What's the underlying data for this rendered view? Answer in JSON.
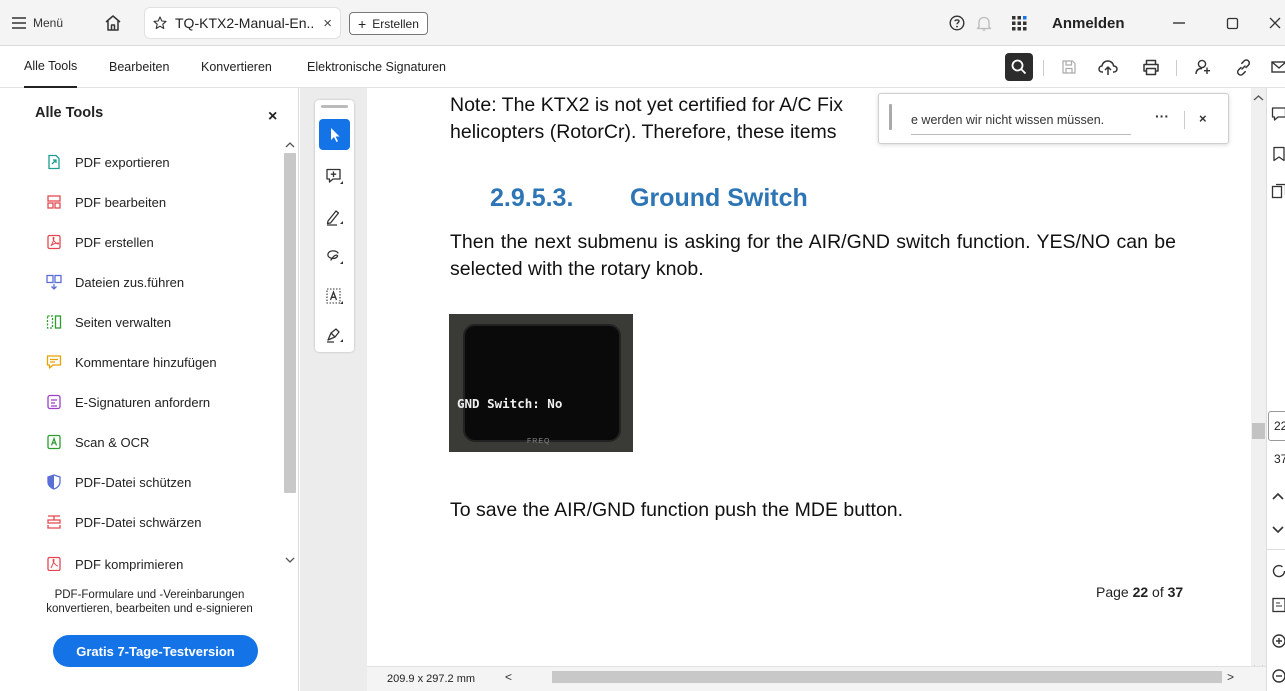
{
  "titlebar": {
    "menu_label": "Menü",
    "tab_title": "TQ-KTX2-Manual-En...",
    "tab_close": "×",
    "create_label": "Erstellen",
    "create_plus": "+",
    "signin_label": "Anmelden"
  },
  "toolsbar": {
    "menus": [
      "Alle Tools",
      "Bearbeiten",
      "Konvertieren",
      "Elektronische Signaturen"
    ]
  },
  "leftpanel": {
    "title": "Alle Tools",
    "close": "×",
    "items": [
      {
        "label": "PDF exportieren",
        "icon": "export-pdf-icon",
        "color": "#1a9e8f"
      },
      {
        "label": "PDF bearbeiten",
        "icon": "edit-pdf-icon",
        "color": "#e34850"
      },
      {
        "label": "PDF erstellen",
        "icon": "create-pdf-icon",
        "color": "#e34850"
      },
      {
        "label": "Dateien zus.führen",
        "icon": "combine-files-icon",
        "color": "#5a6fd6"
      },
      {
        "label": "Seiten verwalten",
        "icon": "organize-pages-icon",
        "color": "#2d9d2d"
      },
      {
        "label": "Kommentare hinzufügen",
        "icon": "comment-icon",
        "color": "#e8a000"
      },
      {
        "label": "E-Signaturen anfordern",
        "icon": "request-signature-icon",
        "color": "#9b3fc9"
      },
      {
        "label": "Scan & OCR",
        "icon": "scan-ocr-icon",
        "color": "#2d9d2d"
      },
      {
        "label": "PDF-Datei schützen",
        "icon": "protect-pdf-icon",
        "color": "#5a6fd6"
      },
      {
        "label": "PDF-Datei schwärzen",
        "icon": "redact-pdf-icon",
        "color": "#e34850"
      },
      {
        "label": "PDF komprimieren",
        "icon": "compress-pdf-icon",
        "color": "#e34850"
      }
    ],
    "promo_line1": "PDF-Formulare und -Vereinbarungen",
    "promo_line2": "konvertieren, bearbeiten und e-signieren",
    "trial_label": "Gratis 7-Tage-Testversion"
  },
  "document": {
    "note_line1": "Note: The KTX2 is not yet certified for A/C Fix",
    "note_line2": "helicopters (RotorCr). Therefore, these items",
    "heading_number": "2.9.5.3.",
    "heading_text": "Ground Switch",
    "paragraph": "Then the next submenu is asking for the AIR/GND switch function. YES/NO can be selected with the rotary knob.",
    "image_lcd_text": "GND Switch: No",
    "image_brand_text": "FREQ",
    "save_text": "To save the AIR/GND function push the MDE button.",
    "page_label_prefix": "Page ",
    "page_current": "22",
    "page_label_mid": " of ",
    "page_total": "37",
    "dimensions": "209.9 x 297.2 mm"
  },
  "toast": {
    "text": "e werden wir nicht wissen müssen.",
    "more": "···",
    "close": "×"
  },
  "rightrail": {
    "page_input": "22",
    "page_total": "37"
  }
}
